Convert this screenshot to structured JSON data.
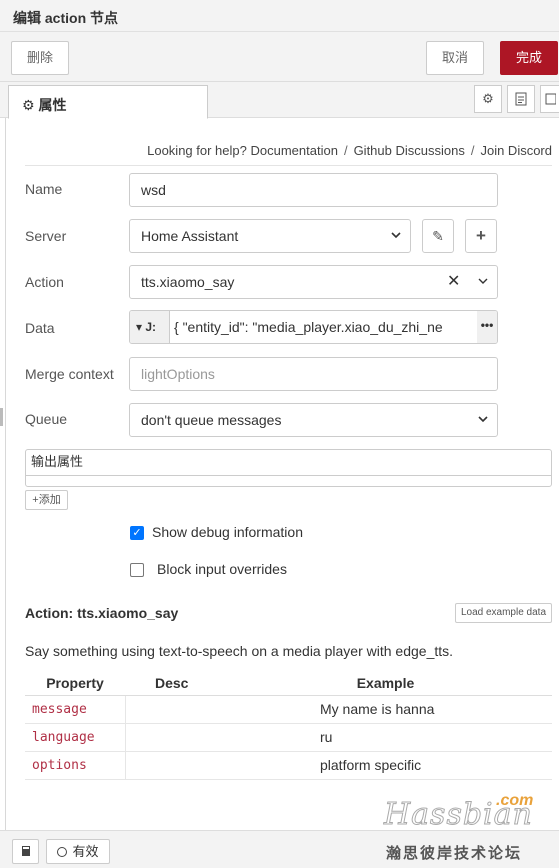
{
  "window": {
    "title": "编辑 action 节点"
  },
  "toolbar": {
    "delete_label": "删除",
    "cancel_label": "取消",
    "done_label": "完成",
    "accent": "#ad1625"
  },
  "tabs": {
    "properties_label": "属性"
  },
  "help": {
    "prefix": "Looking for help?",
    "documentation": "Documentation",
    "github": "Github Discussions",
    "discord": "Join Discord"
  },
  "form": {
    "name": {
      "label": "Name",
      "value": "wsd"
    },
    "server": {
      "label": "Server",
      "value": "Home Assistant"
    },
    "action": {
      "label": "Action",
      "value": "tts.xiaomo_say"
    },
    "data": {
      "label": "Data",
      "type_glyph": "J:",
      "value": "{          \"entity_id\": \"media_player.xiao_du_zhi_ne"
    },
    "merge_context": {
      "label": "Merge context",
      "placeholder": "lightOptions"
    },
    "queue": {
      "label": "Queue",
      "value": "don't queue messages"
    },
    "output": {
      "header": "输出属性",
      "add_label": "添加"
    },
    "show_debug": {
      "label": "Show debug information",
      "checked": true
    },
    "block_input": {
      "label": "Block input overrides",
      "checked": false
    }
  },
  "action_info": {
    "title": "Action: tts.xiaomo_say",
    "load_example_label": "Load example data",
    "description": "Say something using text-to-speech on a media player with edge_tts.",
    "columns": [
      "Property",
      "Desc",
      "Example"
    ],
    "rows": [
      {
        "property": "message",
        "desc": "",
        "example": "My name is hanna"
      },
      {
        "property": "language",
        "desc": "",
        "example": "ru"
      },
      {
        "property": "options",
        "desc": "",
        "example": "platform specific"
      }
    ]
  },
  "footer": {
    "enabled_label": "有效"
  },
  "watermark": {
    "brand": "Hassbian",
    "domain": ".com",
    "tagline": "瀚思彼岸技术论坛"
  }
}
